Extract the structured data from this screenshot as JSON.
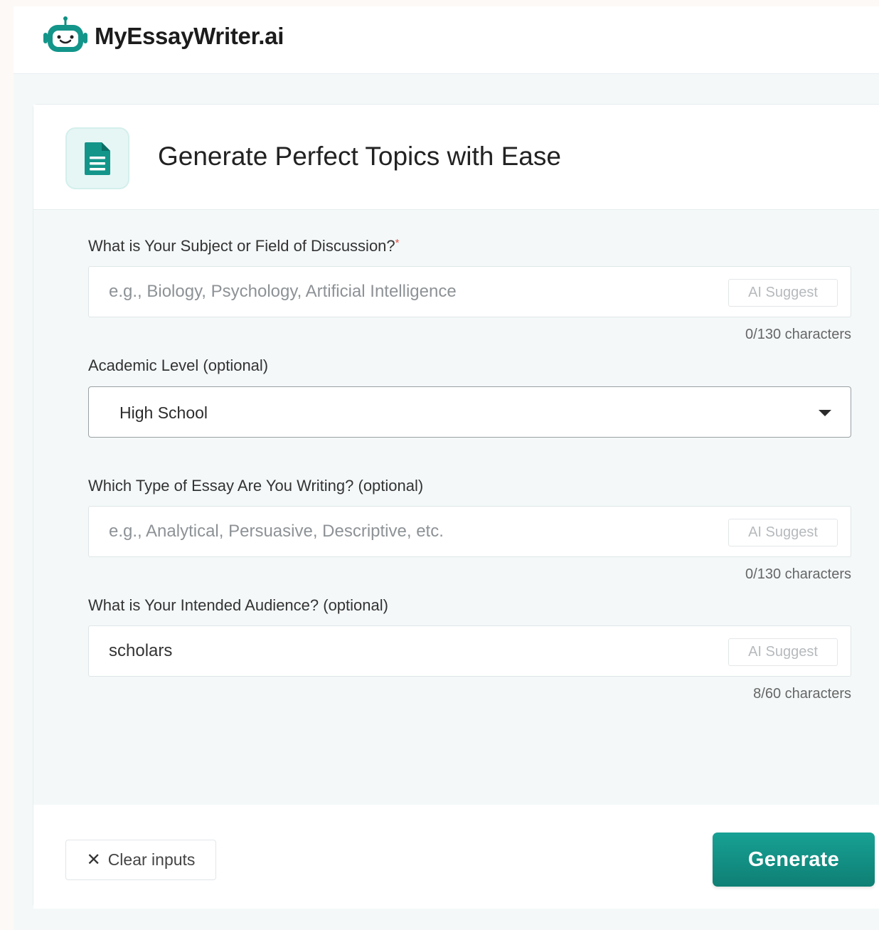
{
  "brand": {
    "name": "MyEssayWriter.ai",
    "accent": "#13958a"
  },
  "card": {
    "title": "Generate Perfect Topics with Ease"
  },
  "form": {
    "subject": {
      "label": "What is Your Subject or Field of Discussion?",
      "required_mark": "*",
      "placeholder": "e.g., Biology, Psychology, Artificial Intelligence",
      "value": "",
      "suggest_label": "AI Suggest",
      "counter": "0/130 characters"
    },
    "level": {
      "label": "Academic Level (optional)",
      "selected": "High School"
    },
    "essay_type": {
      "label": "Which Type of Essay Are You Writing? (optional)",
      "placeholder": "e.g., Analytical, Persuasive, Descriptive, etc.",
      "value": "",
      "suggest_label": "AI Suggest",
      "counter": "0/130 characters"
    },
    "audience": {
      "label": "What is Your Intended Audience? (optional)",
      "placeholder": "",
      "value": "scholars",
      "suggest_label": "AI Suggest",
      "counter": "8/60 characters"
    }
  },
  "actions": {
    "clear_icon": "close-icon",
    "clear_label": "Clear inputs",
    "generate_label": "Generate"
  }
}
